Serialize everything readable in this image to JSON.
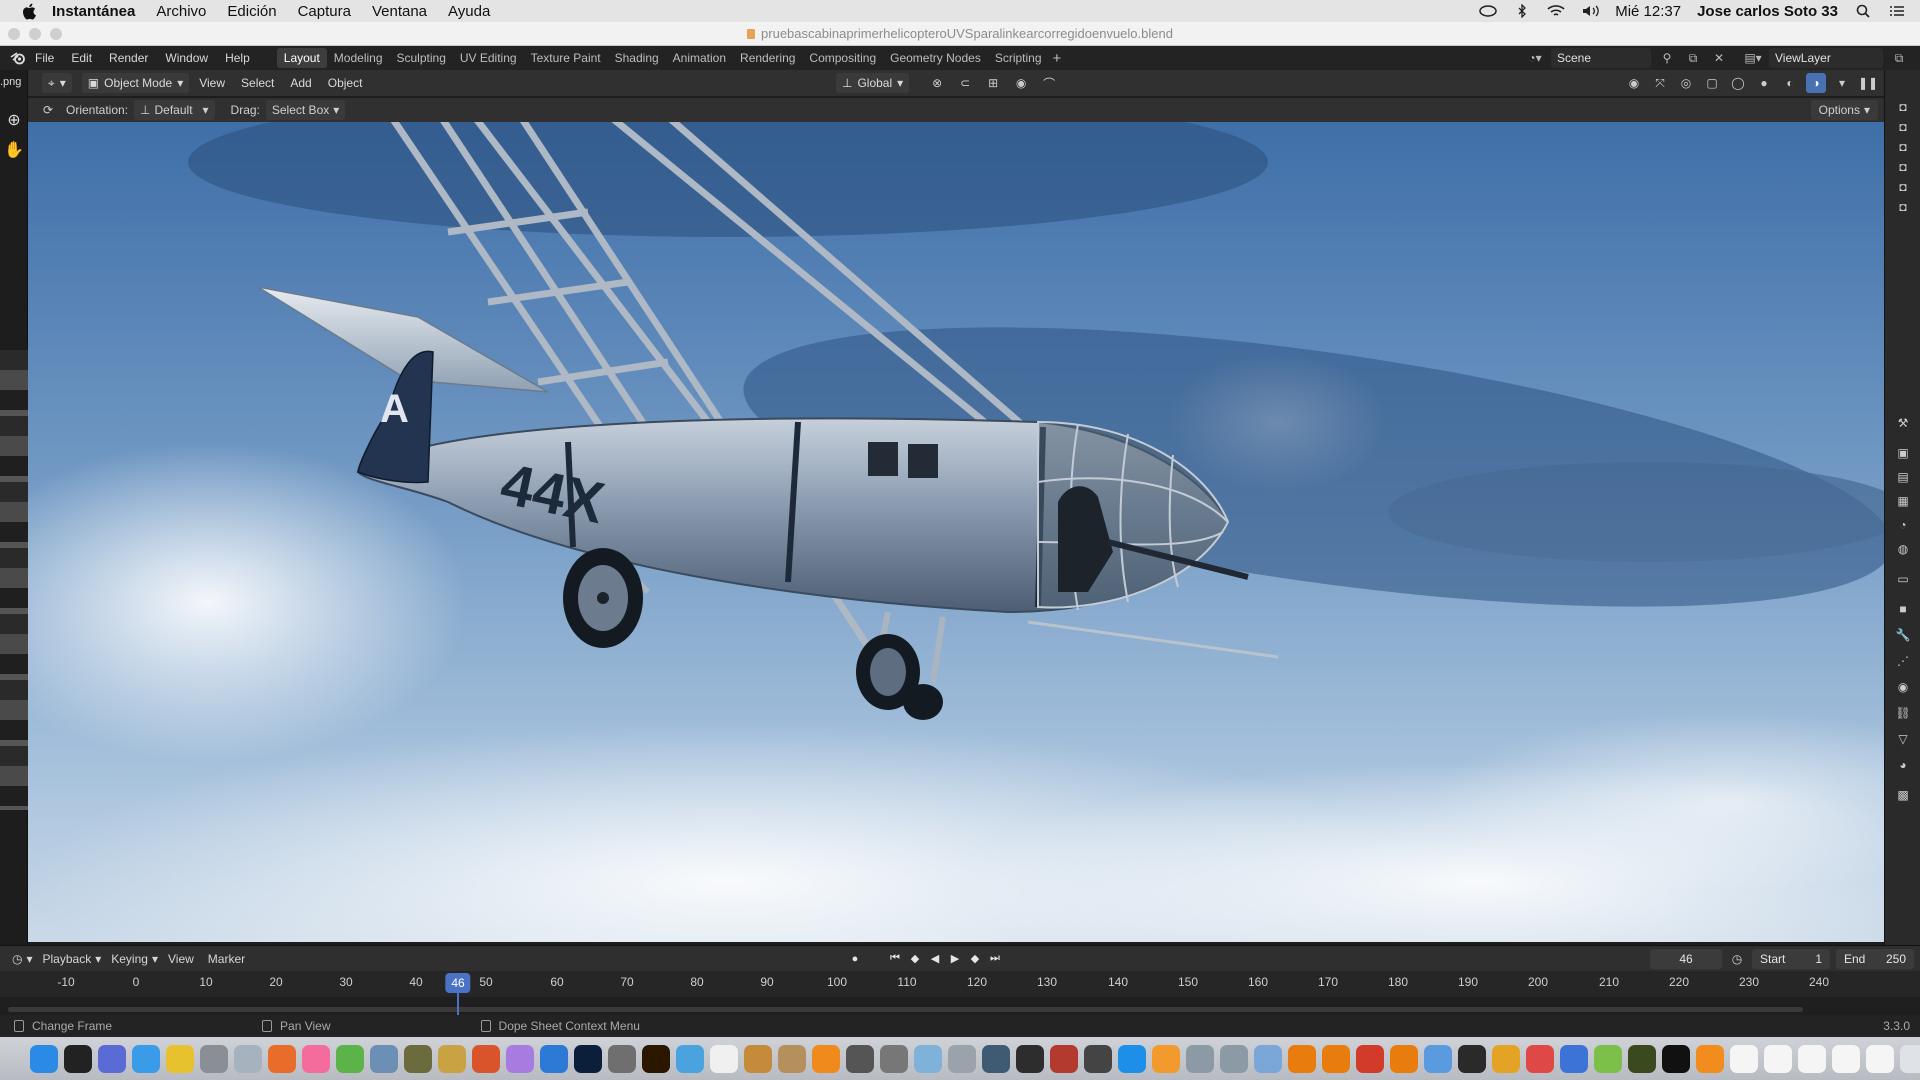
{
  "macos": {
    "app_name": "Instantánea",
    "menus": [
      "Archivo",
      "Edición",
      "Captura",
      "Ventana",
      "Ayuda"
    ],
    "clock": "Mié 12:37",
    "user": "Jose carlos Soto 33"
  },
  "window": {
    "title": "pruebascabinaprimerhelicopteroUVSparalinkearcorregidoenvuelo.blend"
  },
  "topbar": {
    "menus": [
      "File",
      "Edit",
      "Render",
      "Window",
      "Help"
    ],
    "workspaces": [
      "Layout",
      "Modeling",
      "Sculpting",
      "UV Editing",
      "Texture Paint",
      "Shading",
      "Animation",
      "Rendering",
      "Compositing",
      "Geometry Nodes",
      "Scripting"
    ],
    "active_workspace": "Layout",
    "scene": "Scene",
    "view_layer": "ViewLayer"
  },
  "left_strip": {
    "label": ".png"
  },
  "viewport_header": {
    "mode": "Object Mode",
    "menus": [
      "View",
      "Select",
      "Add",
      "Object"
    ],
    "transform_orientation": "Global"
  },
  "tool_header": {
    "orientation_label": "Orientation:",
    "orientation_value": "Default",
    "drag_label": "Drag:",
    "drag_value": "Select Box",
    "options": "Options"
  },
  "aircraft": {
    "tail_marking": "A",
    "fuselage_marking": "44X"
  },
  "timeline": {
    "menus": [
      "Playback",
      "Keying",
      "View",
      "Marker"
    ],
    "current_frame": "46",
    "start_label": "Start",
    "start": "1",
    "end_label": "End",
    "end": "250",
    "ruler": [
      "-10",
      "0",
      "10",
      "20",
      "30",
      "40",
      "50",
      "60",
      "70",
      "80",
      "90",
      "100",
      "110",
      "120",
      "130",
      "140",
      "150",
      "160",
      "170",
      "180",
      "190",
      "200",
      "210",
      "220",
      "230",
      "240"
    ]
  },
  "status": {
    "left": "Change Frame",
    "middle": "Pan View",
    "right": "Dope Sheet Context Menu",
    "version": "3.3.0"
  },
  "colors": {
    "accent": "#4772b3",
    "frame_highlight": "#4a73c6",
    "sky": "#5b86b8"
  }
}
